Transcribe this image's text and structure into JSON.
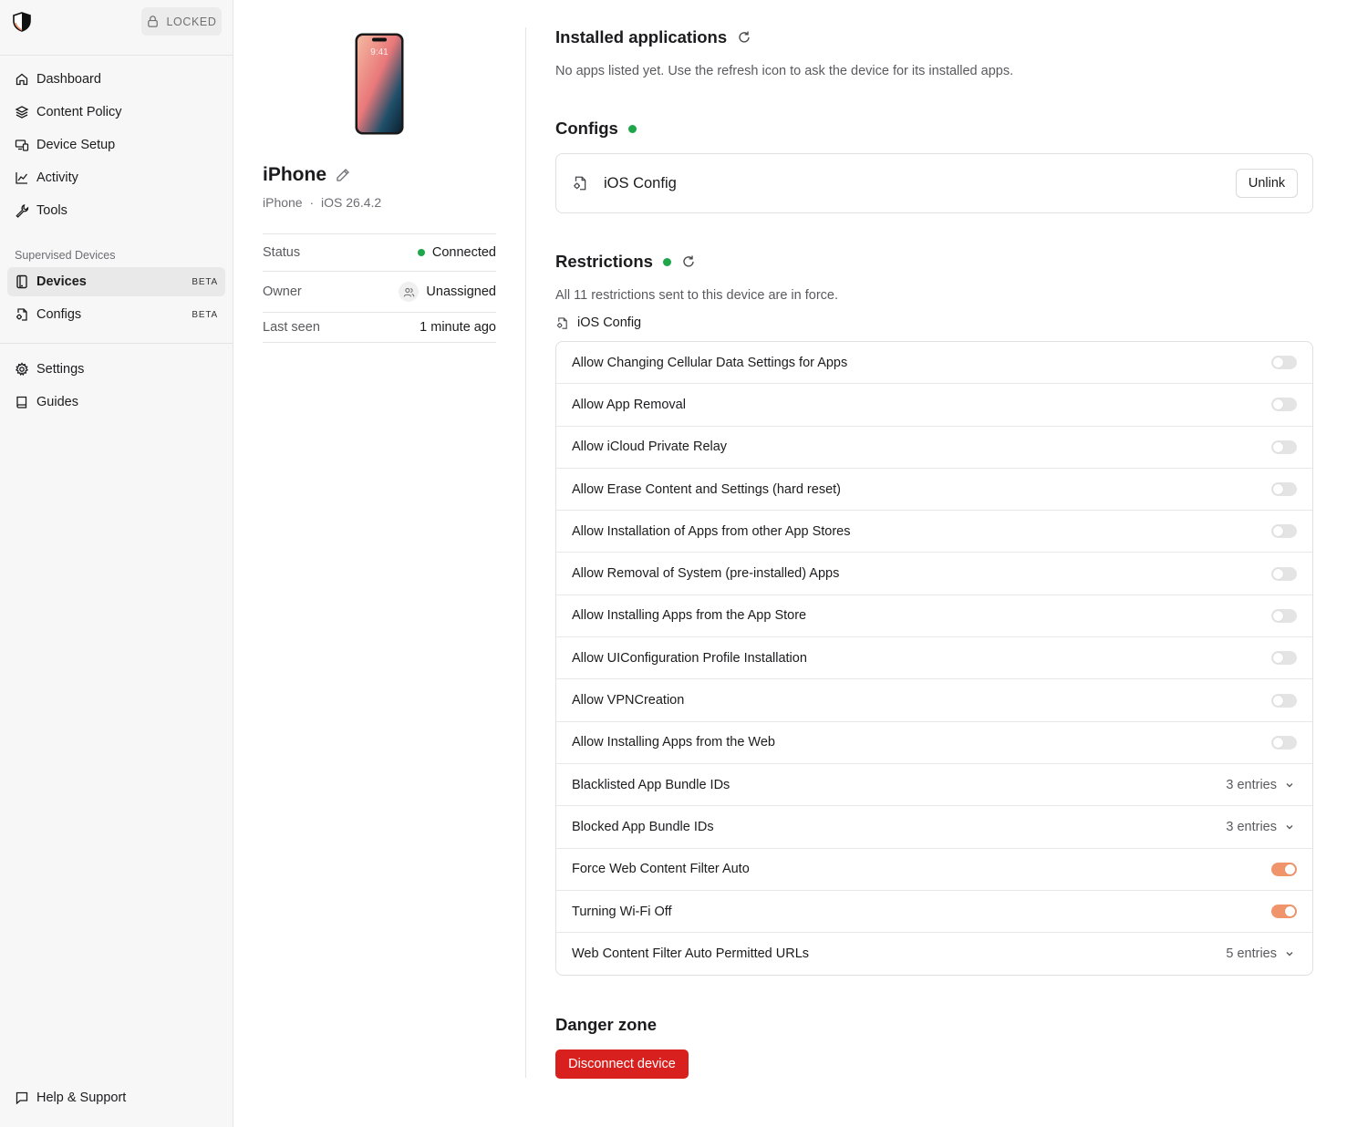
{
  "sidebar": {
    "lock_label": "LOCKED",
    "nav": [
      {
        "label": "Dashboard",
        "icon": "home-icon"
      },
      {
        "label": "Content Policy",
        "icon": "layers-icon"
      },
      {
        "label": "Device Setup",
        "icon": "devices-icon"
      },
      {
        "label": "Activity",
        "icon": "chart-line-icon"
      },
      {
        "label": "Tools",
        "icon": "wrench-icon"
      }
    ],
    "section_label": "Supervised Devices",
    "supervised": [
      {
        "label": "Devices",
        "badge": "BETA",
        "icon": "tablet-icon",
        "active": true
      },
      {
        "label": "Configs",
        "badge": "BETA",
        "icon": "file-gear-icon"
      }
    ],
    "secondary": [
      {
        "label": "Settings",
        "icon": "gear-icon"
      },
      {
        "label": "Guides",
        "icon": "book-icon"
      }
    ],
    "help_label": "Help & Support"
  },
  "device": {
    "phone_time": "9:41",
    "name": "iPhone",
    "model": "iPhone",
    "separator": "·",
    "os": "iOS 26.4.2",
    "status_label": "Status",
    "status_value": "Connected",
    "owner_label": "Owner",
    "owner_value": "Unassigned",
    "last_seen_label": "Last seen",
    "last_seen_value": "1 minute ago"
  },
  "installed": {
    "title": "Installed applications",
    "empty_text": "No apps listed yet. Use the refresh icon to ask the device for its installed apps."
  },
  "configs": {
    "title": "Configs",
    "status_color": "#1fa64a",
    "item_name": "iOS Config",
    "unlink_label": "Unlink"
  },
  "restrictions": {
    "title": "Restrictions",
    "summary": "All 11 restrictions sent to this device are in force.",
    "source": "iOS Config",
    "items": [
      {
        "label": "Allow Changing Cellular Data Settings for Apps",
        "type": "toggle",
        "on": false
      },
      {
        "label": "Allow App Removal",
        "type": "toggle",
        "on": false
      },
      {
        "label": "Allow iCloud Private Relay",
        "type": "toggle",
        "on": false
      },
      {
        "label": "Allow Erase Content and Settings (hard reset)",
        "type": "toggle",
        "on": false
      },
      {
        "label": "Allow Installation of Apps from other App Stores",
        "type": "toggle",
        "on": false
      },
      {
        "label": "Allow Removal of System (pre-installed) Apps",
        "type": "toggle",
        "on": false
      },
      {
        "label": "Allow Installing Apps from the App Store",
        "type": "toggle",
        "on": false
      },
      {
        "label": "Allow UIConfiguration Profile Installation",
        "type": "toggle",
        "on": false
      },
      {
        "label": "Allow VPNCreation",
        "type": "toggle",
        "on": false
      },
      {
        "label": "Allow Installing Apps from the Web",
        "type": "toggle",
        "on": false
      },
      {
        "label": "Blacklisted App Bundle IDs",
        "type": "entries",
        "value": "3 entries"
      },
      {
        "label": "Blocked App Bundle IDs",
        "type": "entries",
        "value": "3 entries"
      },
      {
        "label": "Force Web Content Filter Auto",
        "type": "toggle",
        "on": true
      },
      {
        "label": "Turning Wi-Fi Off",
        "type": "toggle",
        "on": true
      },
      {
        "label": "Web Content Filter Auto Permitted URLs",
        "type": "entries",
        "value": "5 entries"
      }
    ]
  },
  "danger": {
    "title": "Danger zone",
    "button_label": "Disconnect device",
    "button_color": "#d8201e"
  }
}
